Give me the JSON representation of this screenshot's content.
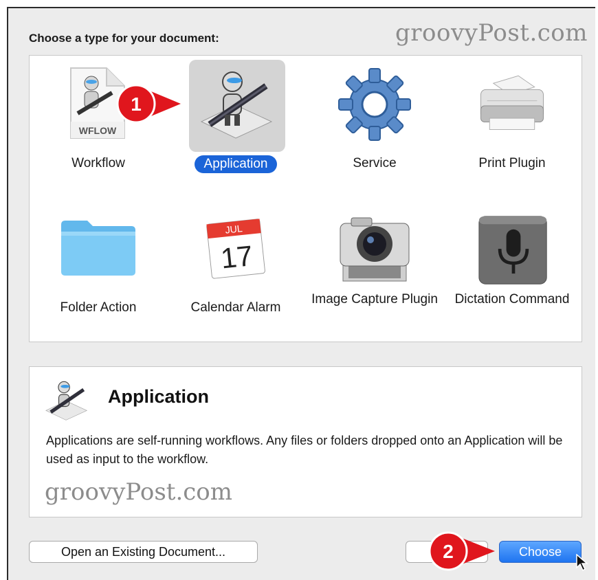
{
  "dialog": {
    "prompt": "Choose a type for your document:",
    "watermark": "groovyPost.com"
  },
  "types": [
    {
      "label": "Workflow",
      "icon": "workflow-icon",
      "badge": "WFLOW"
    },
    {
      "label": "Application",
      "icon": "application-icon",
      "selected": true
    },
    {
      "label": "Service",
      "icon": "gear-icon"
    },
    {
      "label": "Print Plugin",
      "icon": "printer-icon"
    },
    {
      "label": "Folder Action",
      "icon": "folder-icon"
    },
    {
      "label": "Calendar Alarm",
      "icon": "calendar-icon",
      "month": "JUL",
      "day": "17"
    },
    {
      "label": "Image Capture Plugin",
      "icon": "camera-icon"
    },
    {
      "label": "Dictation Command",
      "icon": "microphone-icon"
    }
  ],
  "description": {
    "title": "Application",
    "text": "Applications are self-running workflows. Any files or folders dropped onto an Application will be used as input to the workflow.",
    "watermark": "groovyPost.com"
  },
  "buttons": {
    "open_existing": "Open an Existing Document...",
    "choose": "Choose"
  },
  "callouts": [
    {
      "number": "1",
      "color": "#e0161d"
    },
    {
      "number": "2",
      "color": "#e0161d"
    }
  ],
  "colors": {
    "accent": "#1b64d8",
    "callout": "#e0161d"
  }
}
